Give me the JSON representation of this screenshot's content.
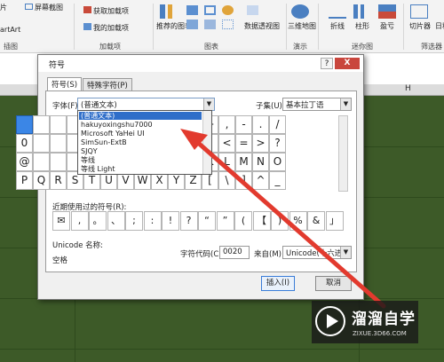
{
  "ribbon": {
    "items": [
      "图片",
      "屏幕截图",
      "获取加载项",
      "我的加载项",
      "推荐的图表",
      "数据透视图",
      "三维地图",
      "折线",
      "柱形",
      "盈亏",
      "切片器",
      "日程表"
    ],
    "partial_left": [
      "片",
      "artArt"
    ],
    "groups": [
      "插图",
      "加载项",
      "图表",
      "演示",
      "迷你图",
      "筛选器"
    ]
  },
  "sheet": {
    "column_h": "H"
  },
  "dialog": {
    "title": "符号",
    "help": "?",
    "close": "X",
    "tabs": [
      "符号(S)",
      "特殊字符(P)"
    ],
    "font_label": "字体(F):",
    "font_value": "(普通文本)",
    "subset_label": "子集(U):",
    "subset_value": "基本拉丁语",
    "font_list": [
      "(普通文本)",
      "hakuyoxingshu7000",
      "Microsoft YaHei UI",
      "SimSun-ExtB",
      "SJQY",
      "等线",
      "等线 Light"
    ],
    "symbols": [
      [
        "",
        "",
        "",
        "",
        "",
        "",
        "",
        "",
        "",
        ")",
        "*",
        "+",
        ",",
        "-",
        ".",
        "/"
      ],
      [
        "0",
        "",
        "",
        "",
        "",
        "",
        "",
        "",
        "",
        "9",
        ":",
        ";",
        "<",
        "=",
        ">",
        "?"
      ],
      [
        "@",
        "",
        "",
        "",
        "",
        "",
        "",
        "",
        "",
        "I",
        "J",
        "K",
        "L",
        "M",
        "N",
        "O"
      ],
      [
        "P",
        "Q",
        "R",
        "S",
        "T",
        "U",
        "V",
        "W",
        "X",
        "Y",
        "Z",
        "[",
        "\\",
        "]",
        "^",
        "_"
      ]
    ],
    "recent_label": "近期使用过的符号(R):",
    "recent": [
      "✉",
      ",",
      "。",
      "、",
      ";",
      ":",
      "!",
      "?",
      "“",
      "”",
      "(",
      "【",
      ")",
      "%",
      "&",
      "」"
    ],
    "unicode_name_label": "Unicode 名称:",
    "unicode_name_value": "空格",
    "char_code_label": "字符代码(C):",
    "char_code_value": "0020",
    "from_label": "来自(M):",
    "from_value": "Unicode(十六进",
    "insert": "插入(I)",
    "cancel": "取消"
  },
  "watermark": {
    "brand": "溜溜自学",
    "url": "ZIXUE.3D66.COM"
  },
  "colors": {
    "sheet_bg": "#3d5a28",
    "selection": "#2f6ec9",
    "arrow": "#e23a2e"
  }
}
